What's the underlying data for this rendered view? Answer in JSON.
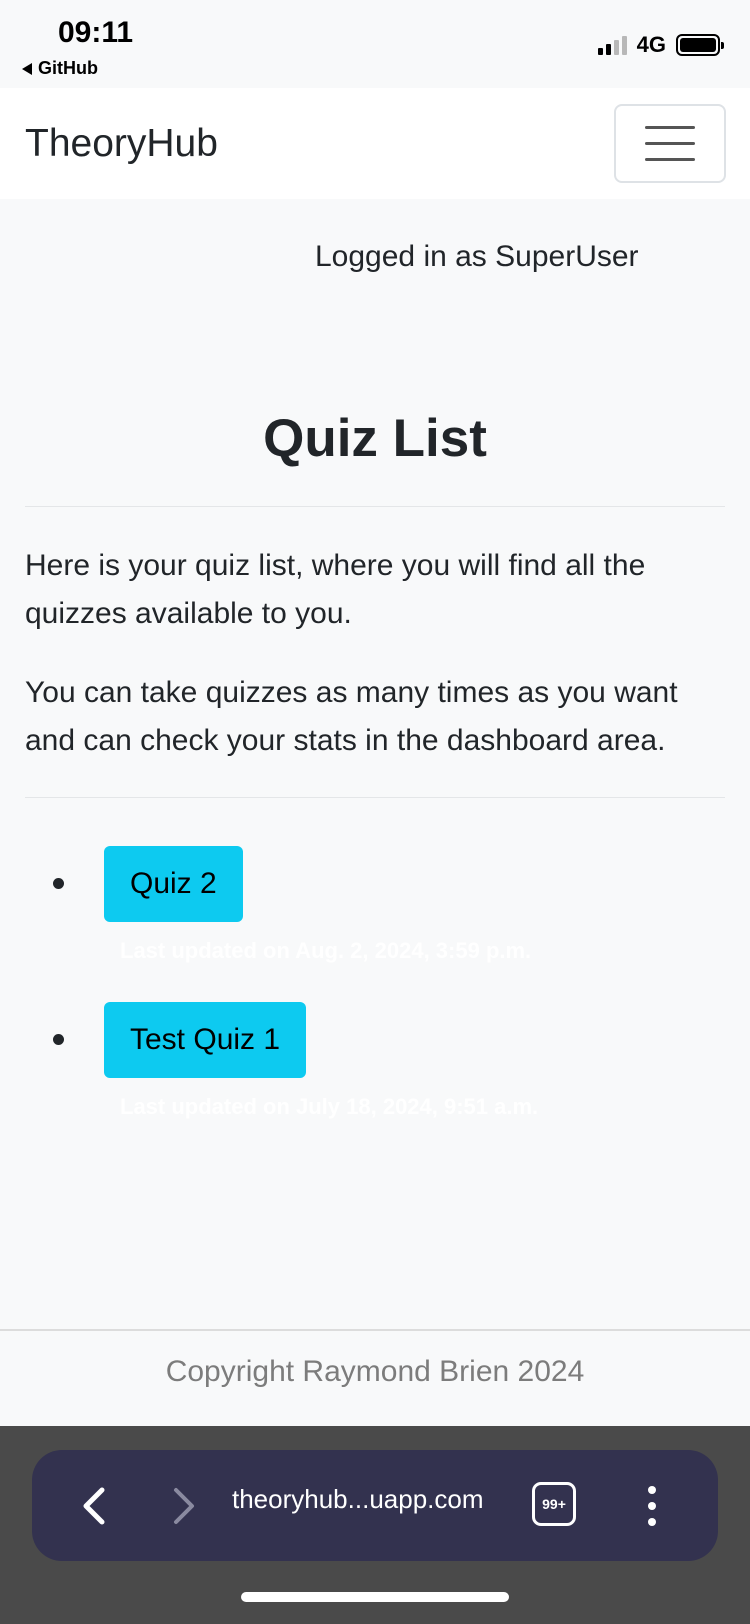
{
  "status_bar": {
    "time": "09:11",
    "back_app": "GitHub",
    "network": "4G",
    "signal_icon": "signal-icon",
    "battery_icon": "battery-icon"
  },
  "navbar": {
    "brand": "TheoryHub",
    "menu_icon": "hamburger-menu-icon"
  },
  "user": {
    "logged_in_text": "Logged in as SuperUser"
  },
  "main": {
    "title": "Quiz List",
    "intro_paragraph_1": "Here is your quiz list, where you will find all the quizzes available to you.",
    "intro_paragraph_2": "You can take quizzes as many times as you want and can check your stats in the dashboard area.",
    "quizzes": [
      {
        "label": "Quiz 2",
        "updated": "Last updated on Aug. 2, 2024, 3:59 p.m."
      },
      {
        "label": "Test Quiz 1",
        "updated": "Last updated on July 18, 2024, 9:51 a.m."
      }
    ],
    "button_color": "#0dcaf0"
  },
  "footer": {
    "copyright": "Copyright Raymond Brien 2024"
  },
  "browser": {
    "url": "theoryhub...uapp.com",
    "tab_count": "99+",
    "back_icon": "chevron-left-icon",
    "forward_icon": "chevron-right-icon",
    "more_icon": "more-vertical-icon"
  }
}
